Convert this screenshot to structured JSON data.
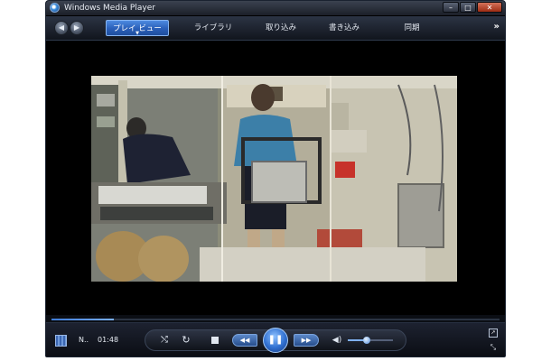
{
  "window": {
    "title": "Windows Media Player",
    "controls": {
      "minimize": "–",
      "maximize": "□",
      "close": "✕"
    }
  },
  "nav": {
    "back": "◀",
    "forward": "▶",
    "tabs": [
      {
        "label": "プレイ ビュー",
        "active": true
      },
      {
        "label": "ライブラリ",
        "active": false
      },
      {
        "label": "取り込み",
        "active": false
      },
      {
        "label": "書き込み",
        "active": false
      },
      {
        "label": "同期",
        "active": false
      }
    ],
    "more": "»"
  },
  "playback": {
    "now_playing": "N..",
    "time": "01:48",
    "seek_progress": 0.14,
    "volume_level": 0.42
  },
  "icons": {
    "shuffle": "⤭",
    "repeat": "↻",
    "prev": "◀◀",
    "pause": "❚❚",
    "next": "▶▶",
    "volume": "◀)",
    "mini_mode": "↗",
    "fullscreen": "⤡"
  },
  "colors": {
    "accent": "#2f6fd0",
    "background": "#000000"
  }
}
